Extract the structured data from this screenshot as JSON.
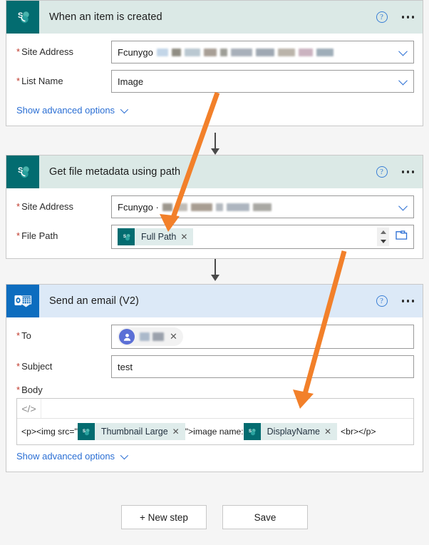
{
  "app": {
    "accent_orange": "#f2802a",
    "sharepoint_teal": "#036c70",
    "outlook_blue": "#0d6dbf",
    "link_blue": "#2b6fd4"
  },
  "steps": [
    {
      "title": "When an item is created",
      "connector": "sharepoint",
      "icon_name": "sharepoint-icon",
      "help_label": "?",
      "fields": [
        {
          "label": "Site Address",
          "required": true,
          "value": "Fcunygo",
          "redacted": true,
          "control": "dropdown"
        },
        {
          "label": "List Name",
          "required": true,
          "value": "Image",
          "redacted": false,
          "control": "dropdown"
        }
      ],
      "advanced_link": "Show advanced options"
    },
    {
      "title": "Get file metadata using path",
      "connector": "sharepoint",
      "icon_name": "sharepoint-icon",
      "help_label": "?",
      "fields": [
        {
          "label": "Site Address",
          "required": true,
          "value": "Fcunygo ·",
          "redacted": true,
          "control": "dropdown"
        },
        {
          "label": "File Path",
          "required": true,
          "token": "Full Path",
          "control": "token-picker"
        }
      ]
    },
    {
      "title": "Send an email (V2)",
      "connector": "outlook",
      "icon_name": "outlook-icon",
      "help_label": "?",
      "fields": [
        {
          "label": "To",
          "required": true,
          "control": "people-picker",
          "redacted": true
        },
        {
          "label": "Subject",
          "required": true,
          "value": "test",
          "control": "text"
        }
      ],
      "body": {
        "label": "Body",
        "required": true,
        "code_button": "</>",
        "segments": [
          {
            "type": "text",
            "value": "<p><img src=\""
          },
          {
            "type": "token",
            "value": "Thumbnail Large"
          },
          {
            "type": "text",
            "value": "\">image name:"
          },
          {
            "type": "token",
            "value": "DisplayName"
          },
          {
            "type": "text",
            "value": "<br></p>"
          }
        ]
      },
      "advanced_link": "Show advanced options"
    }
  ],
  "footer": {
    "new_step_label": "+ New step",
    "save_label": "Save"
  },
  "annotations": [
    {
      "name": "arrow-to-full-path",
      "color": "#f2802a"
    },
    {
      "name": "arrow-to-displayname",
      "color": "#f2802a"
    }
  ]
}
